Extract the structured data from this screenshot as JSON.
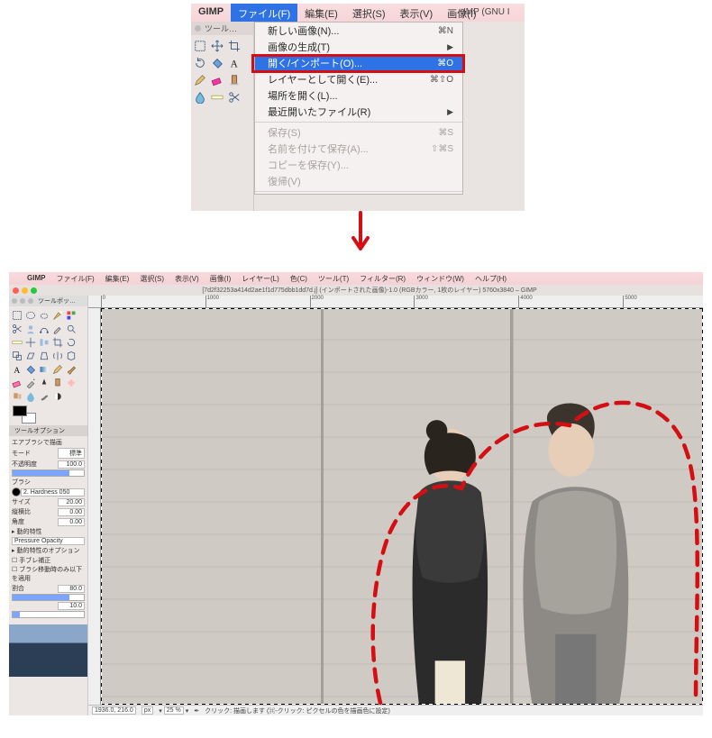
{
  "top": {
    "menubar": {
      "app": "GIMP",
      "items": [
        "ファイル(F)",
        "編集(E)",
        "選択(S)",
        "表示(V)",
        "画像(I)"
      ],
      "open_index": 0
    },
    "toolbox_title": "ツール…",
    "titlebar_fragment": "IMP (GNU I",
    "dropdown": {
      "rows": [
        {
          "label": "新しい画像(N)...",
          "shortcut": "⌘N"
        },
        {
          "label": "画像の生成(T)",
          "submenu": true
        },
        {
          "label": "開く/インポート(O)...",
          "shortcut": "⌘O",
          "highlight": true
        },
        {
          "label": "レイヤーとして開く(E)...",
          "shortcut": "⌘⇧O"
        },
        {
          "label": "場所を開く(L)..."
        },
        {
          "label": "最近開いたファイル(R)",
          "submenu": true
        },
        {
          "sep": true
        },
        {
          "label": "保存(S)",
          "shortcut": "⌘S",
          "disabled": true
        },
        {
          "label": "名前を付けて保存(A)...",
          "shortcut": "⇧⌘S",
          "disabled": true
        },
        {
          "label": "コピーを保存(Y)...",
          "disabled": true
        },
        {
          "label": "復帰(V)",
          "disabled": true
        },
        {
          "sep": true
        }
      ]
    }
  },
  "bottom": {
    "menubar": {
      "items": [
        "GIMP",
        "ファイル(F)",
        "編集(E)",
        "選択(S)",
        "表示(V)",
        "画像(I)",
        "レイヤー(L)",
        "色(C)",
        "ツール(T)",
        "フィルター(R)",
        "ウィンドウ(W)",
        "ヘルプ(H)"
      ]
    },
    "titlebar": "[7d2f32253a414d2ae1f1d775dbb1dd7d.j] (インポートされた画像)-1.0 (RGBカラー, 1枚のレイヤー) 5760x3840 – GIMP",
    "toolbox": {
      "title": "ツールボッ…"
    },
    "tool_options": {
      "header": "ツールオプション",
      "tool_label": "エアブラシで描画",
      "mode_label": "モード",
      "mode_value": "標準",
      "opacity_label": "不透明度",
      "opacity_value": "100.0",
      "brush_label": "ブラシ",
      "brush_name": "2. Hardness 050",
      "rows": [
        {
          "label": "サイズ",
          "value": "20.00"
        },
        {
          "label": "縦横比",
          "value": "0.00"
        },
        {
          "label": "角度",
          "value": "0.00"
        }
      ],
      "dynamics_label": "動的特性",
      "dynamics_value": "Pressure Opacity",
      "dyn_opts_label": "動的特性のオプション",
      "jitter_label": "手ブレ補正",
      "move_label": "ブラシ移動時のみ以下を適用",
      "rate_label": "割合",
      "rate_value": "80.0",
      "flow_value": "10.0"
    },
    "ruler_ticks": [
      "0",
      "1000",
      "2000",
      "3000",
      "4000",
      "5000"
    ],
    "status": {
      "coords": "1936.0, 216.0",
      "unit": "px",
      "zoom": "25 %",
      "hint": "クリック: 描画します (⌘-クリック: ピクセルの色を描画色に設定)",
      "cursor_icon": "airbrush-icon"
    }
  },
  "accent": "#d40f14"
}
